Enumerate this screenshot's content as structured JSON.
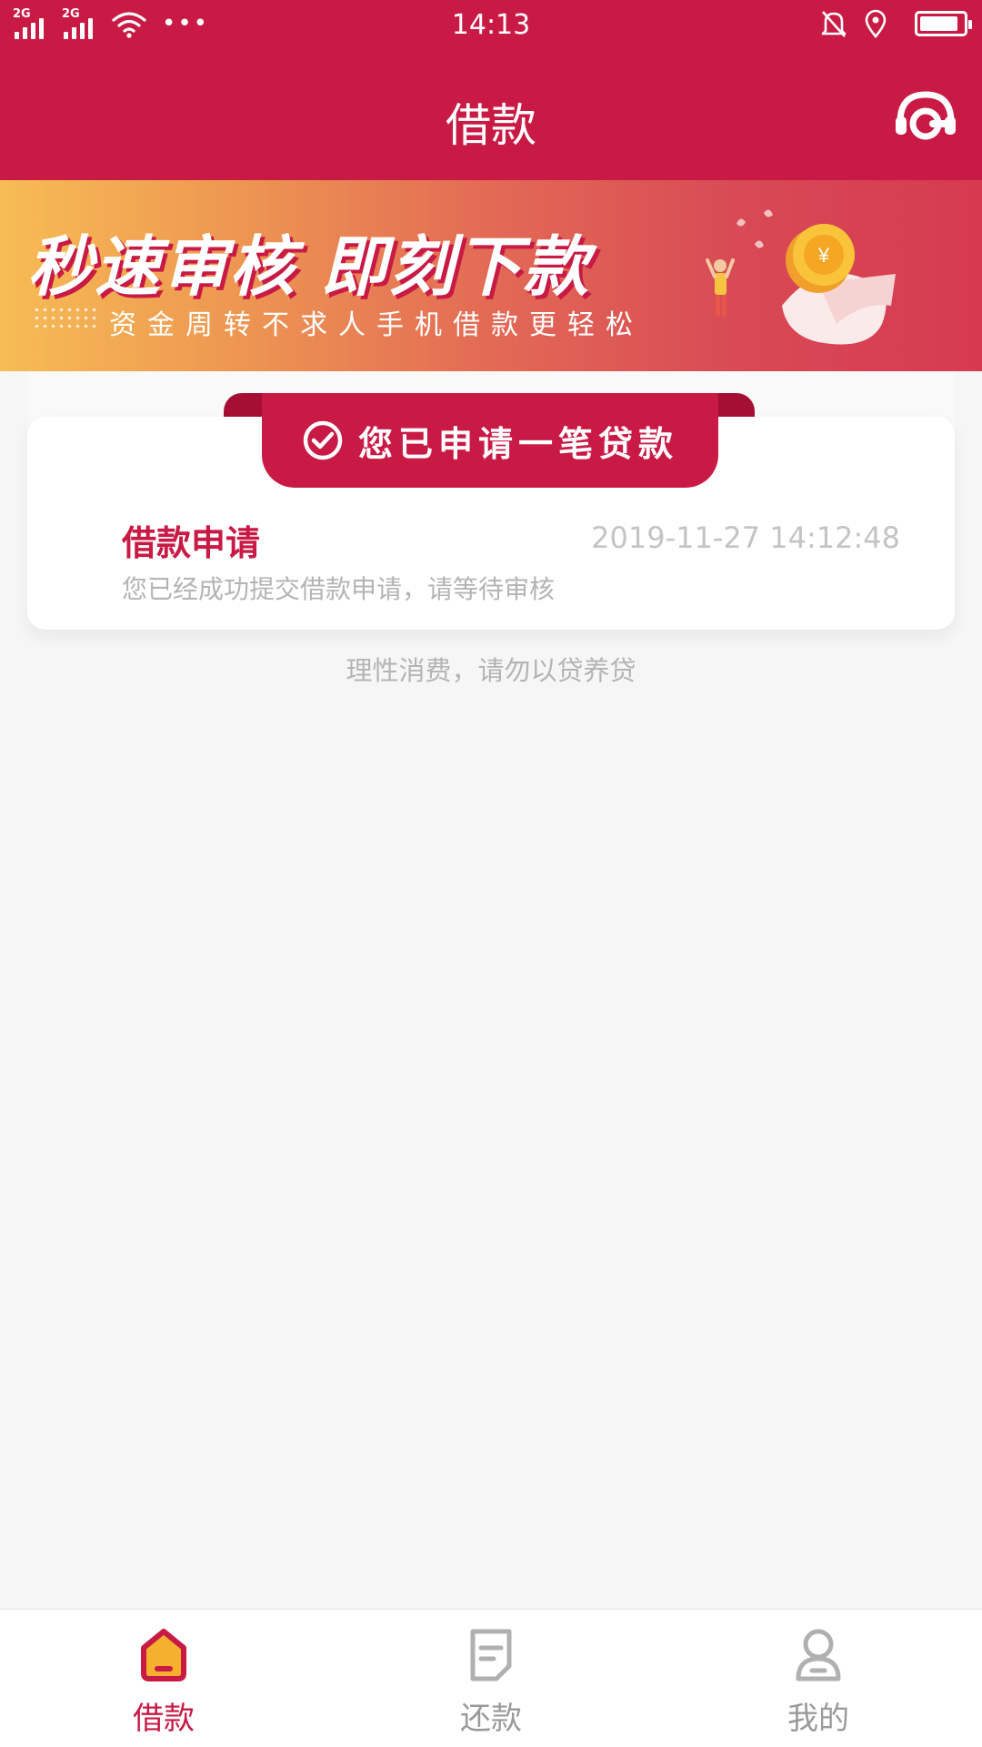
{
  "status_bar": {
    "network1": "2G",
    "network2": "2G",
    "more": "•••",
    "time": "14:13",
    "battery_level": 0.9
  },
  "header": {
    "title": "借款",
    "service_icon": "headset-icon"
  },
  "banner": {
    "headline": "秒速审核 即刻下款",
    "subline": "资金周转不求人手机借款更轻松",
    "art_icon": "gold-coin-icon"
  },
  "application": {
    "ribbon": "您已申请一笔贷款",
    "ribbon_icon": "check-circle-icon",
    "title": "借款申请",
    "time": "2019-11-27 14:12:48",
    "description": "您已经成功提交借款申请，请等待审核"
  },
  "footer_tip": "理性消费，请勿以贷养贷",
  "tabs": [
    {
      "label": "借款",
      "icon": "home-icon",
      "active": true
    },
    {
      "label": "还款",
      "icon": "document-icon",
      "active": false
    },
    {
      "label": "我的",
      "icon": "user-icon",
      "active": false
    }
  ],
  "colors": {
    "primary": "#c81a45",
    "background": "#f6f6f6",
    "muted_text": "#b4b4b4"
  }
}
